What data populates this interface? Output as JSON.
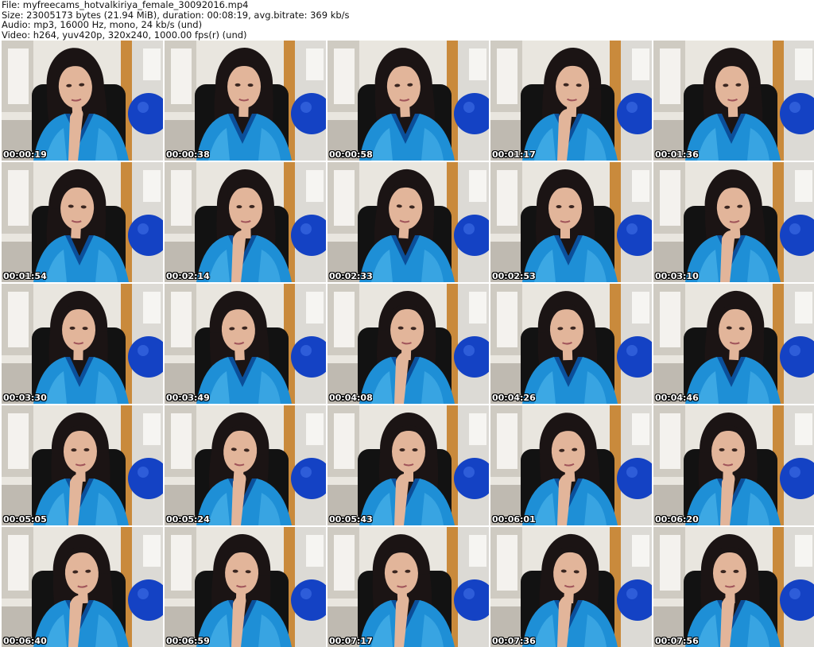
{
  "header": {
    "file_line": "File: myfreecams_hotvalkiriya_female_30092016.mp4",
    "size_line": "Size: 23005173 bytes (21.94 MiB), duration: 00:08:19, avg.bitrate: 369 kb/s",
    "audio_line": "Audio: mp3, 16000 Hz, mono, 24 kb/s (und)",
    "video_line": "Video: h264, yuv420p, 320x240, 1000.00 fps(r) (und)"
  },
  "thumbnails": [
    {
      "timestamp": "00:00:19"
    },
    {
      "timestamp": "00:00:38"
    },
    {
      "timestamp": "00:00:58"
    },
    {
      "timestamp": "00:01:17"
    },
    {
      "timestamp": "00:01:36"
    },
    {
      "timestamp": "00:01:54"
    },
    {
      "timestamp": "00:02:14"
    },
    {
      "timestamp": "00:02:33"
    },
    {
      "timestamp": "00:02:53"
    },
    {
      "timestamp": "00:03:10"
    },
    {
      "timestamp": "00:03:30"
    },
    {
      "timestamp": "00:03:49"
    },
    {
      "timestamp": "00:04:08"
    },
    {
      "timestamp": "00:04:26"
    },
    {
      "timestamp": "00:04:46"
    },
    {
      "timestamp": "00:05:05"
    },
    {
      "timestamp": "00:05:24"
    },
    {
      "timestamp": "00:05:43"
    },
    {
      "timestamp": "00:06:01"
    },
    {
      "timestamp": "00:06:20"
    },
    {
      "timestamp": "00:06:40"
    },
    {
      "timestamp": "00:06:59"
    },
    {
      "timestamp": "00:07:17"
    },
    {
      "timestamp": "00:07:36"
    },
    {
      "timestamp": "00:07:56"
    }
  ],
  "colors": {
    "robe": "#1e8fd6",
    "robe_dark": "#0b4f9a",
    "hair": "#1b1414",
    "skin": "#e2b59a",
    "ball": "#1442c4",
    "wall": "#e9e6df",
    "door": "#c98a3c",
    "chair": "#121212"
  }
}
